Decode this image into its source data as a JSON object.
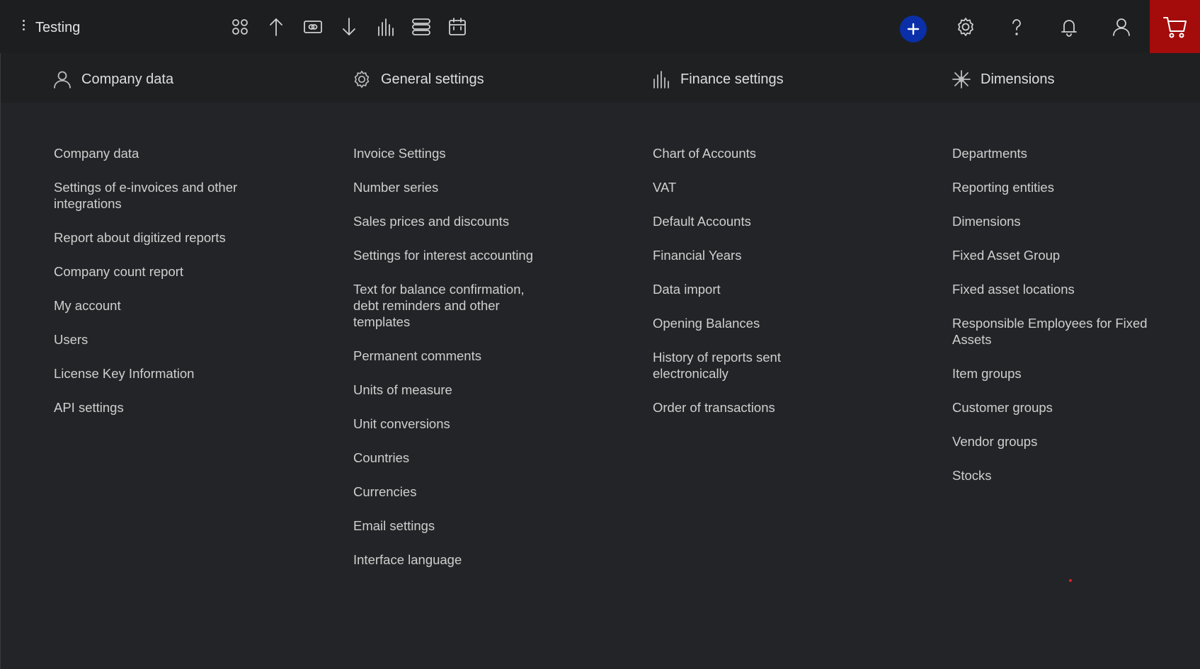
{
  "header": {
    "title": "Testing",
    "toolbar_icons": [
      "apps-icon",
      "upload-icon",
      "cash-icon",
      "download-icon",
      "chart-icon",
      "list-icon",
      "calendar-icon"
    ],
    "right_icons": [
      "plus-icon",
      "gear-icon",
      "help-icon",
      "bell-icon",
      "user-icon",
      "cart-icon"
    ],
    "accent": "#0a2fa8",
    "cart_color": "#a40b0b"
  },
  "tabs": [
    {
      "label": "Company data",
      "icon": "user-icon"
    },
    {
      "label": "General settings",
      "icon": "gear-icon"
    },
    {
      "label": "Finance settings",
      "icon": "chart-icon"
    },
    {
      "label": "Dimensions",
      "icon": "asterisk-icon"
    }
  ],
  "columns": [
    {
      "items": [
        "Company data",
        "Settings of e-invoices and other integrations",
        "Report about digitized reports",
        "Company count report",
        "My account",
        "Users",
        "License Key Information",
        "API settings"
      ]
    },
    {
      "items": [
        "Invoice Settings",
        "Number series",
        "Sales prices and discounts",
        "Settings for interest accounting",
        "Text for balance confirmation, debt reminders and other templates",
        "Permanent comments",
        "Units of measure",
        "Unit conversions",
        "Countries",
        "Currencies",
        "Email settings",
        "Interface language"
      ]
    },
    {
      "items": [
        "Chart of Accounts",
        "VAT",
        "Default Accounts",
        "Financial Years",
        "Data import",
        "Opening Balances",
        "History of reports sent electronically",
        "Order of transactions"
      ]
    },
    {
      "items": [
        "Departments",
        "Reporting entities",
        "Dimensions",
        "Fixed Asset Group",
        "Fixed asset locations",
        "Responsible Employees for Fixed Assets",
        "Item groups",
        "Customer groups",
        "Vendor groups",
        "Stocks"
      ]
    }
  ]
}
